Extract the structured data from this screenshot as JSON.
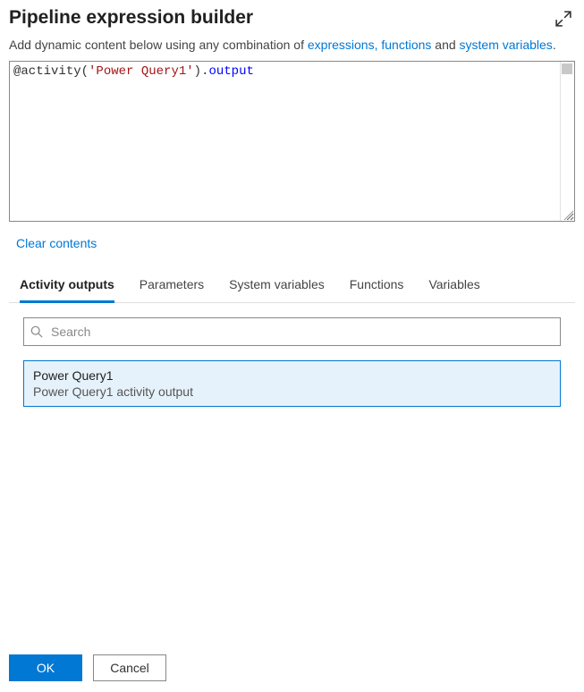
{
  "header": {
    "title": "Pipeline expression builder"
  },
  "subtitle": {
    "prefix": "Add dynamic content below using any combination of ",
    "link1": "expressions, functions",
    "mid": " and ",
    "link2": "system variables",
    "suffix": "."
  },
  "expression": {
    "raw": "@activity('Power Query1').output",
    "tokens": {
      "at": "@",
      "fn": "activity",
      "open": "(",
      "arg": "'Power Query1'",
      "close": ")",
      "dot": ".",
      "prop": "output"
    }
  },
  "actions": {
    "clear": "Clear contents"
  },
  "tabs": [
    {
      "id": "activity-outputs",
      "label": "Activity outputs",
      "active": true
    },
    {
      "id": "parameters",
      "label": "Parameters",
      "active": false
    },
    {
      "id": "system-variables",
      "label": "System variables",
      "active": false
    },
    {
      "id": "functions",
      "label": "Functions",
      "active": false
    },
    {
      "id": "variables",
      "label": "Variables",
      "active": false
    }
  ],
  "search": {
    "placeholder": "Search",
    "value": ""
  },
  "results": [
    {
      "title": "Power Query1",
      "description": "Power Query1 activity output",
      "selected": true
    }
  ],
  "footer": {
    "ok": "OK",
    "cancel": "Cancel"
  }
}
